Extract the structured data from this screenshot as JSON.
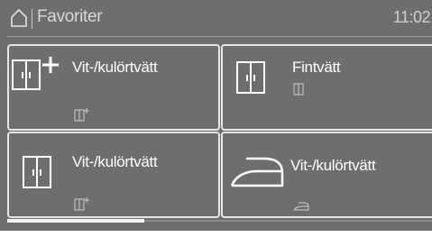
{
  "header": {
    "title": "Favoriter",
    "clock": "11:02",
    "home_icon": "home-icon"
  },
  "tiles": [
    {
      "label": "Vit-/kulörtvätt",
      "icon": "wardrobe-plus-icon",
      "sub_icon": "small-wardrobe-plus-icon"
    },
    {
      "label": "Fintvätt",
      "icon": "wardrobe-icon",
      "sub_icon": "small-wardrobe-icon"
    },
    {
      "label": "Vit-/kulörtvätt",
      "icon": "wardrobe-icon",
      "sub_icon": "small-wardrobe-plus-icon"
    },
    {
      "label": "Vit-/kulörtvätt",
      "icon": "iron-icon",
      "sub_icon": "small-iron-icon"
    }
  ],
  "scroll": {
    "position_fraction": 0.0,
    "visible_fraction": 0.32
  },
  "colors": {
    "background": "#6e6e6e",
    "text": "#ffffff",
    "border": "#e6e6e6"
  }
}
